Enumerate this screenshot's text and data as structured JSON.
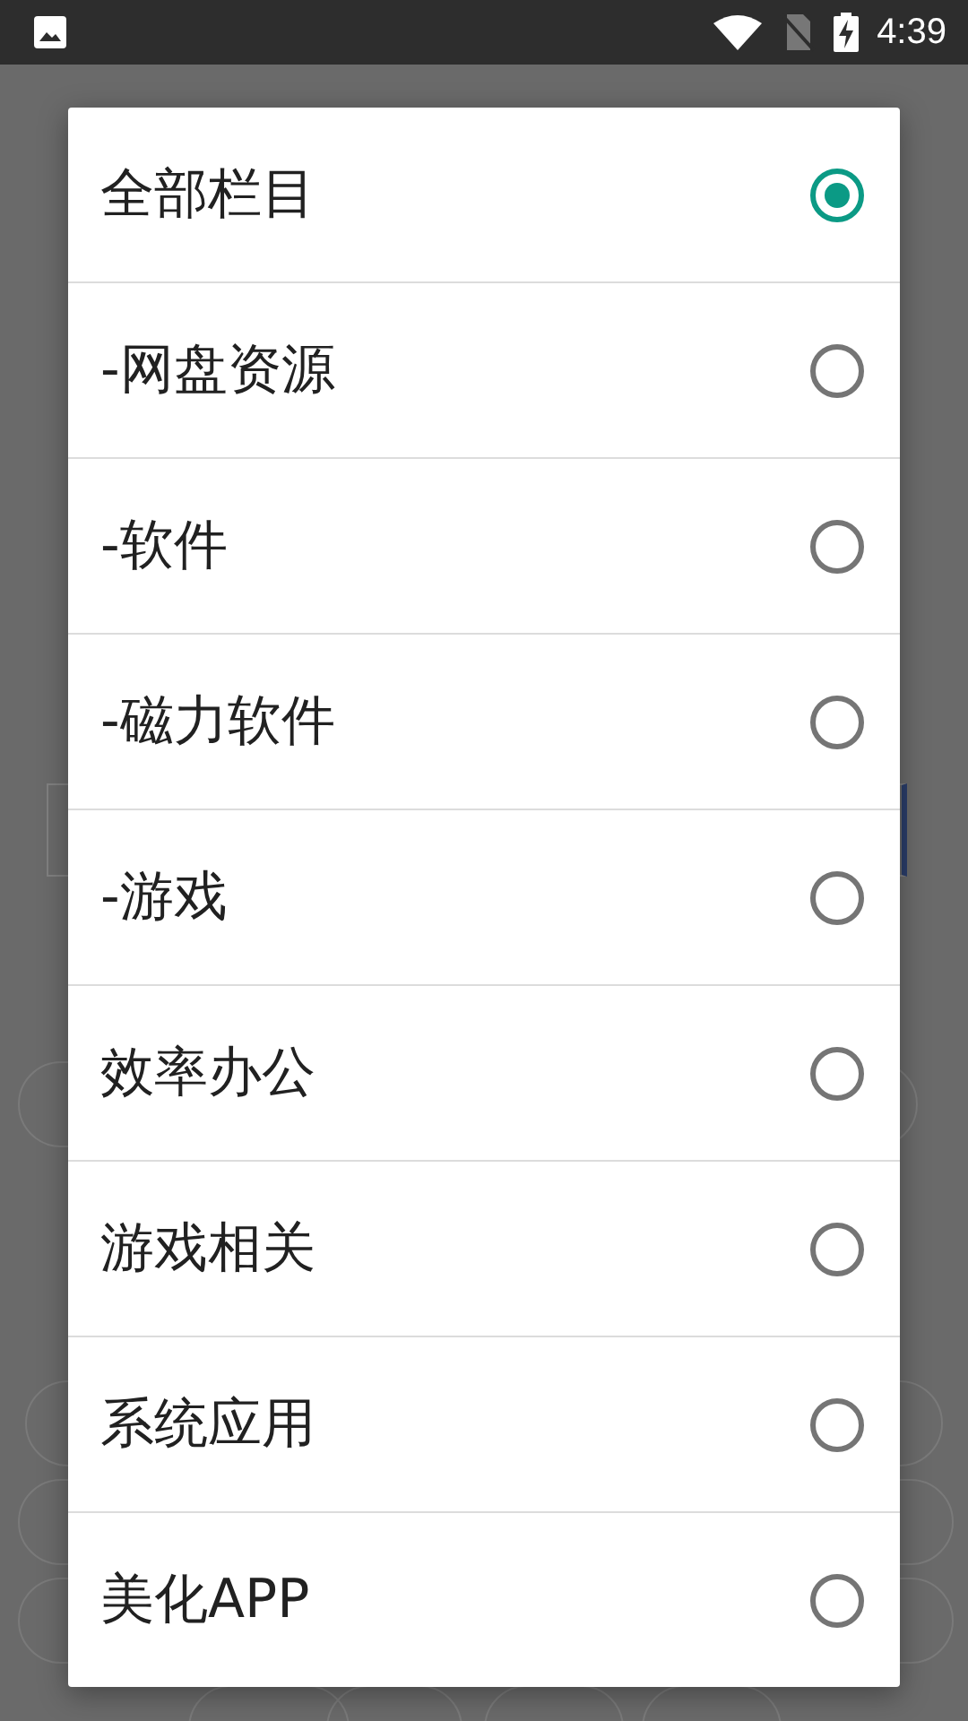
{
  "status_bar": {
    "time": "4:39"
  },
  "dialog": {
    "options": [
      {
        "label": "全部栏目",
        "selected": true
      },
      {
        "label": "-网盘资源",
        "selected": false
      },
      {
        "label": "-软件",
        "selected": false
      },
      {
        "label": "-磁力软件",
        "selected": false
      },
      {
        "label": "-游戏",
        "selected": false
      },
      {
        "label": "效率办公",
        "selected": false
      },
      {
        "label": "游戏相关",
        "selected": false
      },
      {
        "label": "系统应用",
        "selected": false
      },
      {
        "label": "美化APP",
        "selected": false
      }
    ]
  }
}
